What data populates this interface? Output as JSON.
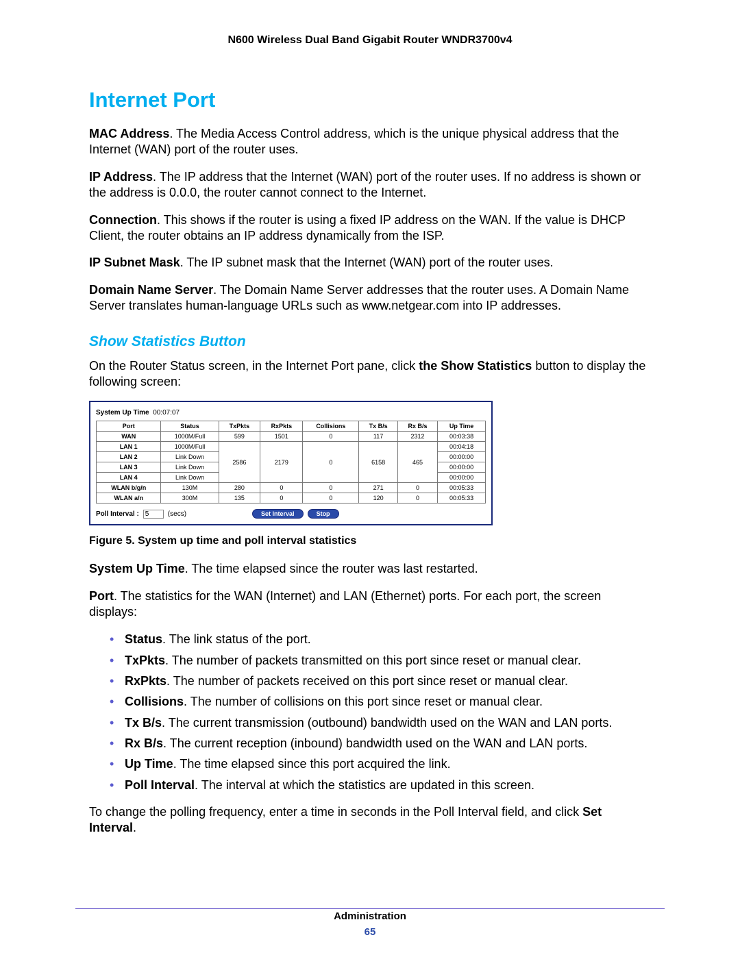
{
  "header": {
    "title": "N600 Wireless Dual Band Gigabit Router WNDR3700v4"
  },
  "section": {
    "heading": "Internet Port",
    "paragraphs": {
      "mac_label": "MAC Address",
      "mac_text": ". The Media Access Control address, which is the unique physical address that the Internet (WAN) port of the router uses.",
      "ip_label": "IP Address",
      "ip_text": ". The IP address that the Internet (WAN) port of the router uses. If no address is shown or the address is 0.0.0, the router cannot connect to the Internet.",
      "conn_label": "Connection",
      "conn_text": ". This shows if the router is using a fixed IP address on the WAN. If the value is DHCP Client, the router obtains an IP address dynamically from the ISP.",
      "subnet_label": "IP Subnet Mask",
      "subnet_text": ". The IP subnet mask that the Internet (WAN) port of the router uses.",
      "dns_label": "Domain Name Server",
      "dns_text": ". The Domain Name Server addresses that the router uses. A Domain Name Server translates human-language URLs such as www.netgear.com into IP addresses."
    }
  },
  "subheading": "Show Statistics Button",
  "intro_before": "On the Router Status screen, in the Internet Port pane, click ",
  "intro_bold": "the Show Statistics",
  "intro_after": " button to display the following screen:",
  "figure": {
    "uptime_label": "System Up Time",
    "uptime_value": "00:07:07",
    "headers": [
      "Port",
      "Status",
      "TxPkts",
      "RxPkts",
      "Collisions",
      "Tx B/s",
      "Rx B/s",
      "Up Time"
    ],
    "rows": [
      {
        "port": "WAN",
        "status": "1000M/Full",
        "tx": "599",
        "rx": "1501",
        "col": "0",
        "txbs": "117",
        "rxbs": "2312",
        "up": "00:03:38"
      },
      {
        "port": "LAN 1",
        "status": "1000M/Full",
        "tx": "",
        "rx": "",
        "col": "",
        "txbs": "",
        "rxbs": "",
        "up": "00:04:18"
      },
      {
        "port": "LAN 2",
        "status": "Link Down",
        "tx": "",
        "rx": "",
        "col": "",
        "txbs": "",
        "rxbs": "",
        "up": "00:00:00"
      },
      {
        "port": "LAN 3",
        "status": "Link Down",
        "tx": "",
        "rx": "",
        "col": "",
        "txbs": "",
        "rxbs": "",
        "up": "00:00:00"
      },
      {
        "port": "LAN 4",
        "status": "Link Down",
        "tx": "",
        "rx": "",
        "col": "",
        "txbs": "",
        "rxbs": "",
        "up": "00:00:00"
      },
      {
        "port": "WLAN b/g/n",
        "status": "130M",
        "tx": "280",
        "rx": "0",
        "col": "0",
        "txbs": "271",
        "rxbs": "0",
        "up": "00:05:33"
      },
      {
        "port": "WLAN a/n",
        "status": "300M",
        "tx": "135",
        "rx": "0",
        "col": "0",
        "txbs": "120",
        "rxbs": "0",
        "up": "00:05:33"
      }
    ],
    "lan_merged": {
      "tx": "2586",
      "rx": "2179",
      "col": "0",
      "txbs": "6158",
      "rxbs": "465"
    },
    "poll_label": "Poll Interval :",
    "poll_value": "5",
    "poll_unit": "(secs)",
    "btn_set": "Set Interval",
    "btn_stop": "Stop",
    "caption": "Figure 5. System up time and poll interval statistics"
  },
  "sysup_label": "System Up Time",
  "sysup_text": ". The time elapsed since the router was last restarted.",
  "port_label": "Port",
  "port_text": ". The statistics for the WAN (Internet) and LAN (Ethernet) ports. For each port, the screen displays:",
  "bullets": [
    {
      "label": "Status",
      "text": ". The link status of the port."
    },
    {
      "label": "TxPkts",
      "text": ". The number of packets transmitted on this port since reset or manual clear."
    },
    {
      "label": "RxPkts",
      "text": ". The number of packets received on this port since reset or manual clear."
    },
    {
      "label": "Collisions",
      "text": ". The number of collisions on this port since reset or manual clear."
    },
    {
      "label": "Tx B/s",
      "text": ". The current transmission (outbound) bandwidth used on the WAN and LAN ports."
    },
    {
      "label": "Rx B/s",
      "text": ". The current reception (inbound) bandwidth used on the WAN and LAN ports."
    },
    {
      "label": "Up Time",
      "text": ". The time elapsed since this port acquired the link."
    },
    {
      "label": "Poll Interval",
      "text": ". The interval at which the statistics are updated in this screen."
    }
  ],
  "closing_before": "To change the polling frequency, enter a time in seconds in the Poll Interval field, and click ",
  "closing_bold": "Set Interval",
  "closing_after": ".",
  "footer": {
    "section": "Administration",
    "page": "65"
  }
}
